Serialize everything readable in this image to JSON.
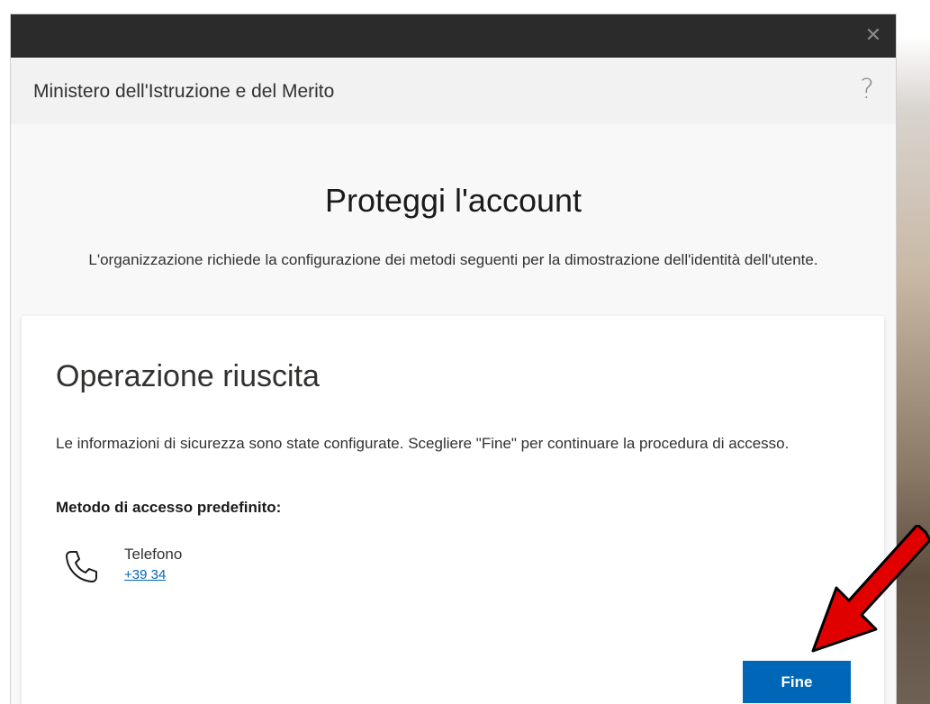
{
  "window": {
    "close_glyph": "✕"
  },
  "header": {
    "org_name": "Ministero dell'Istruzione e del Merito",
    "help_glyph": "?"
  },
  "page": {
    "title": "Proteggi l'account",
    "subtitle": "L'organizzazione richiede la configurazione dei metodi seguenti per la dimostrazione dell'identità dell'utente."
  },
  "card": {
    "title": "Operazione riuscita",
    "text": "Le informazioni di sicurezza sono state configurate. Scegliere \"Fine\" per continuare la procedura di accesso.",
    "method_label": "Metodo di accesso predefinito:",
    "method": {
      "icon": "phone-icon",
      "name": "Telefono",
      "number": "+39 34"
    },
    "done_button": "Fine"
  },
  "colors": {
    "accent": "#0067b8",
    "titlebar": "#2b2b2b",
    "header_bg": "#f2f2f2",
    "annotation_arrow": "#e00000"
  }
}
